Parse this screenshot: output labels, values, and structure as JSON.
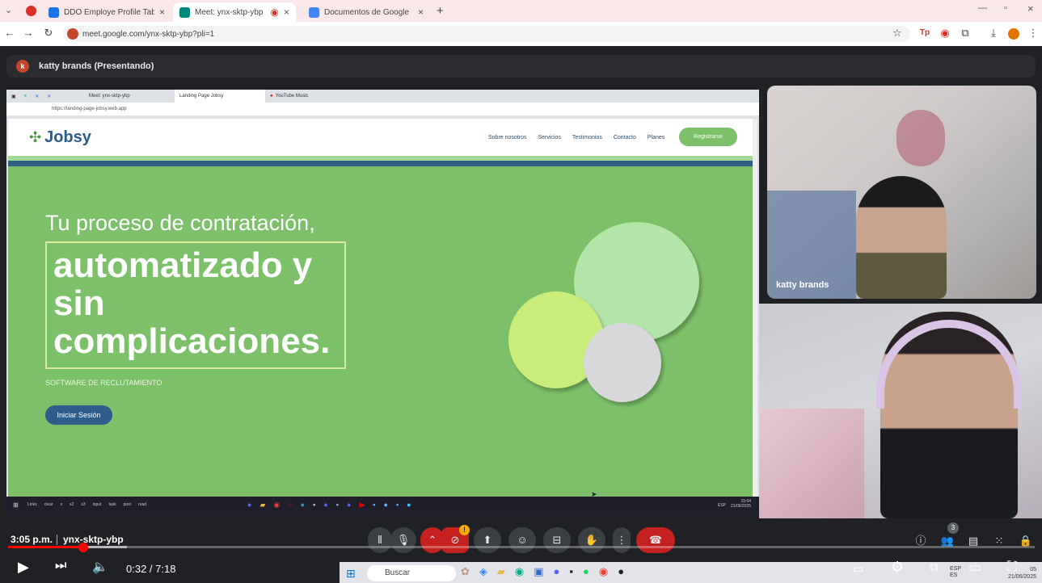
{
  "browser": {
    "tabs": [
      {
        "title": "DDO Employe Profile Table Co",
        "icon": "doc-icon",
        "color": "#1a73e8"
      },
      {
        "title": "Meet: ynx-sktp-ybp",
        "icon": "meet-icon",
        "color": "#00897b",
        "active": true
      },
      {
        "title": "Documentos de Google",
        "icon": "docs-icon",
        "color": "#4285f4"
      }
    ],
    "url": "meet.google.com/ynx-sktp-ybp?pli=1"
  },
  "meet": {
    "presenter_initial": "k",
    "presenter_label": "katty brands (Presentando)",
    "participant_name": "katty brands",
    "participants_badge": "3",
    "camera_badge": "!",
    "time": "3:05 p.m.",
    "meeting_code": "ynx-sktp-ybp"
  },
  "shared": {
    "tabs": [
      "Meet: ynx-sktp-ybp",
      "Landing Page Jobsy",
      "YouTube Music"
    ],
    "url": "https://landing-page-jobsy.web.app",
    "site": {
      "logo": "Jobsy",
      "nav": [
        "Sobre nosotros",
        "Servicios",
        "Testimonios",
        "Contacto",
        "Planes"
      ],
      "register": "Registrarse",
      "hero_line": "Tu proceso de contratación,",
      "hero_big": [
        "automatizado y",
        "sin",
        "complicaciones."
      ],
      "subtitle": "SOFTWARE DE RECLUTAMIENTO",
      "login": "Iniciar Sesión"
    },
    "taskbar_items": [
      "Links",
      "clear",
      "x",
      "s2",
      "s3",
      "input",
      "task",
      "post",
      "read"
    ],
    "clock": "15:04",
    "date": "21/06/2025",
    "lang": "ESP"
  },
  "player": {
    "time": "0:32 / 7:18",
    "progress": 0.073
  },
  "windows": {
    "search": "Buscar",
    "lang": "ESP",
    "lang2": "ES",
    "clock": "05",
    "date": "21/06/2025"
  }
}
